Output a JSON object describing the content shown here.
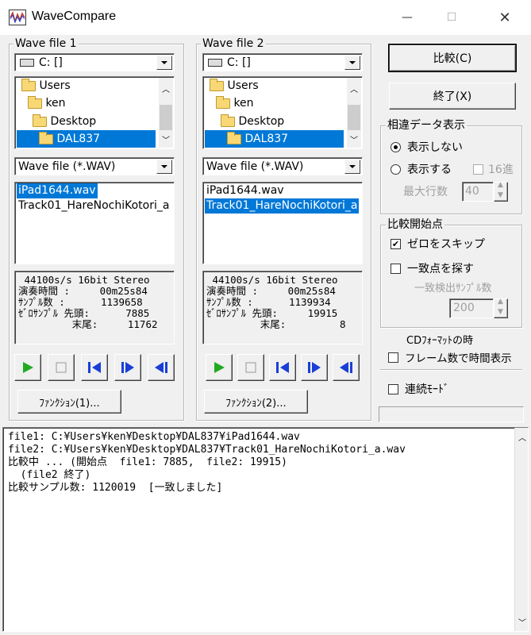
{
  "window": {
    "title": "WaveCompare",
    "minimize_glyph": "—",
    "maximize_glyph": "☐",
    "close_glyph": "✕"
  },
  "file1": {
    "group_label": "Wave file 1",
    "drive": "C: []",
    "folders": [
      "Users",
      "ken",
      "Desktop",
      "DAL837"
    ],
    "filter": "Wave file (*.WAV)",
    "files": [
      "iPad1644.wav",
      "Track01_HareNochiKotori_a"
    ],
    "selected_file_index": 0,
    "info": {
      "format": " 44100s/s 16bit Stereo",
      "duration": "演奏時間 :     00m25s84",
      "samples": "ｻﾝﾌﾟﾙ数 :      1139658",
      "zero_head": "ｾﾞﾛｻﾝﾌﾟﾙ 先頭:      7885",
      "zero_tail": "         末尾:     11762"
    },
    "function_button": "ﾌｧﾝｸｼｮﾝ(1)..."
  },
  "file2": {
    "group_label": "Wave file 2",
    "drive": "C: []",
    "folders": [
      "Users",
      "ken",
      "Desktop",
      "DAL837"
    ],
    "filter": "Wave file (*.WAV)",
    "files": [
      "iPad1644.wav",
      "Track01_HareNochiKotori_a"
    ],
    "selected_file_index": 1,
    "info": {
      "format": " 44100s/s 16bit Stereo",
      "duration": "演奏時間 :     00m25s84",
      "samples": "ｻﾝﾌﾟﾙ数 :      1139934",
      "zero_head": "ｾﾞﾛｻﾝﾌﾟﾙ 先頭:     19915",
      "zero_tail": "         末尾:         8"
    },
    "function_button": "ﾌｧﾝｸｼｮﾝ(2)..."
  },
  "buttons": {
    "compare": "比較(C)",
    "exit": "終了(X)"
  },
  "diff_display": {
    "group_label": "相違データ表示",
    "option_hide": "表示しない",
    "option_show": "表示する",
    "selected": "hide",
    "hex16_label": "16進",
    "hex16_checked": false,
    "max_rows_label": "最大行数",
    "max_rows_value": "40"
  },
  "compare_start": {
    "group_label": "比較開始点",
    "skip_zero_label": "ゼロをスキップ",
    "skip_zero_checked": true,
    "find_match_label": "一致点を探す",
    "find_match_checked": false,
    "match_samples_label": "一致検出ｻﾝﾌﾟﾙ数",
    "match_samples_value": "200"
  },
  "cd_format": {
    "heading": "CDﾌｫｰﾏｯﾄの時",
    "frame_label": "フレーム数で時間表示",
    "frame_checked": false
  },
  "continuous": {
    "label": "連続ﾓｰﾄﾞ",
    "checked": false
  },
  "log_lines": [
    "file1: C:¥Users¥ken¥Desktop¥DAL837¥iPad1644.wav",
    "file2: C:¥Users¥ken¥Desktop¥DAL837¥Track01_HareNochiKotori_a.wav",
    "比較中 ... (開始点  file1: 7885,  file2: 19915)",
    "  (file2 終了)",
    "比較サンプル数: 1120019  [一致しました]"
  ],
  "colors": {
    "selection": "#0078d7",
    "play_green": "#22aa22",
    "transport_blue": "#1a3fd6"
  }
}
